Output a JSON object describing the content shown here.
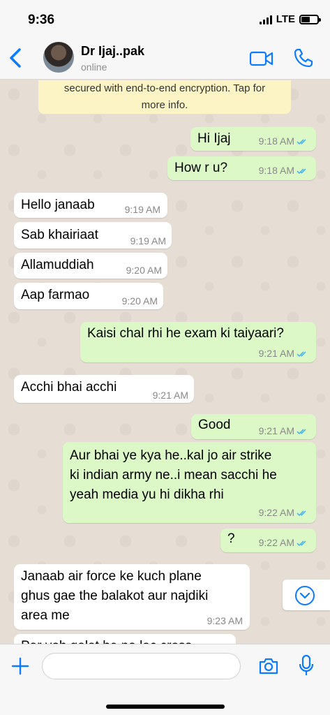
{
  "status_bar": {
    "time": "9:36",
    "network": "LTE",
    "battery_level": 0.55
  },
  "header": {
    "back_icon": "chevron-left-icon",
    "contact_name": "Dr Ijaj..pak",
    "contact_status": "online",
    "video_icon": "video-camera-icon",
    "call_icon": "phone-icon"
  },
  "encryption_notice": {
    "line1": "secured with end-to-end encryption. Tap for",
    "line2": "more info."
  },
  "messages": [
    {
      "direction": "out",
      "text": "Hi Ijaj",
      "time": "9:18 AM",
      "read": true
    },
    {
      "direction": "out",
      "text": "How r u?",
      "time": "9:18 AM",
      "read": true
    },
    {
      "direction": "in",
      "text": "Hello janaab",
      "time": "9:19 AM"
    },
    {
      "direction": "in",
      "text": "Sab khairiaat",
      "time": "9:19 AM"
    },
    {
      "direction": "in",
      "text": "Allamuddiah",
      "time": "9:20 AM"
    },
    {
      "direction": "in",
      "text": "Aap farmao",
      "time": "9:20 AM"
    },
    {
      "direction": "out",
      "text": "Kaisi chal rhi he exam ki taiyaari?",
      "time": "9:21 AM",
      "read": true
    },
    {
      "direction": "in",
      "text": "Acchi bhai acchi",
      "time": "9:21 AM"
    },
    {
      "direction": "out",
      "text": "Good",
      "time": "9:21 AM",
      "read": true
    },
    {
      "direction": "out",
      "lines": [
        "Aur bhai ye kya he..kal jo air strike",
        "ki indian army ne..i mean sacchi he",
        "yeah media yu hi dikha rhi"
      ],
      "time": "9:22 AM",
      "read": true
    },
    {
      "direction": "out",
      "text": "?",
      "time": "9:22 AM",
      "read": true
    },
    {
      "direction": "in",
      "lines": [
        "Janaab air force ke kuch plane",
        "ghus gae the balakot aur najdiki",
        "area me"
      ],
      "time": "9:23 AM"
    },
    {
      "direction": "in",
      "text": "Par voh galat he na loc cross",
      "partial": true
    }
  ],
  "scroll_down_icon": "chevron-down-circle-icon",
  "input_bar": {
    "attach_icon": "plus-icon",
    "message_value": "",
    "camera_icon": "camera-icon",
    "mic_icon": "microphone-icon"
  },
  "colors": {
    "accent": "#0a7aff",
    "outgoing_bubble": "#dcf8c6",
    "incoming_bubble": "#ffffff",
    "read_ticks": "#4fb6ec",
    "encryption_banner": "#fdf4c5"
  }
}
